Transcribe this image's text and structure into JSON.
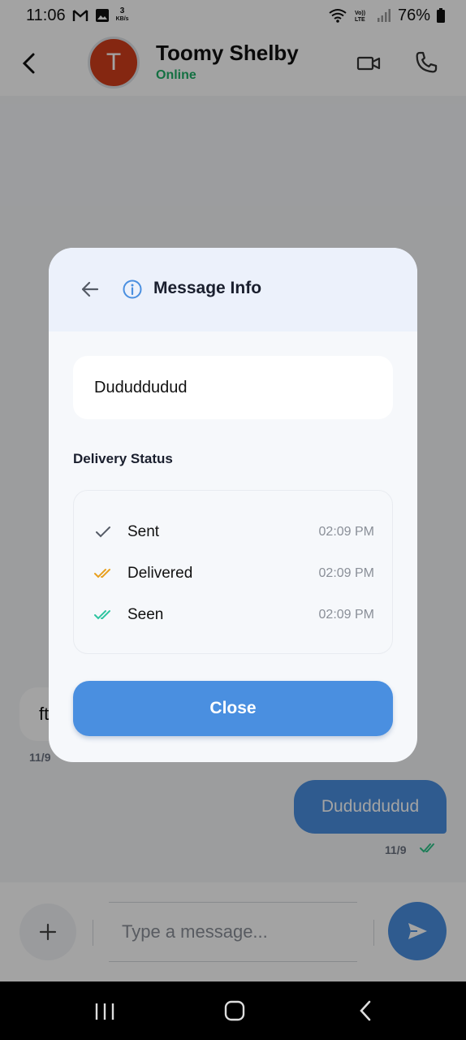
{
  "status_bar": {
    "time": "11:06",
    "kbs_value": "3",
    "kbs_unit": "KB/s",
    "battery": "76%"
  },
  "header": {
    "avatar_letter": "T",
    "contact_name": "Toomy Shelby",
    "contact_status": "Online"
  },
  "chat": {
    "incoming_text": "ft",
    "incoming_time": "11/9",
    "outgoing_text": "Dududdudud",
    "outgoing_time": "11/9"
  },
  "composer": {
    "placeholder": "Type a message..."
  },
  "dialog": {
    "title": "Message Info",
    "message_text": "Dududdudud",
    "section_title": "Delivery Status",
    "statuses": [
      {
        "label": "Sent",
        "time": "02:09 PM",
        "color": "#555b66"
      },
      {
        "label": "Delivered",
        "time": "02:09 PM",
        "color": "#e8a020"
      },
      {
        "label": "Seen",
        "time": "02:09 PM",
        "color": "#2ec4a0"
      }
    ],
    "close_label": "Close"
  },
  "colors": {
    "accent": "#4a8fe0",
    "online": "#20b068",
    "avatar": "#d03e1c"
  }
}
